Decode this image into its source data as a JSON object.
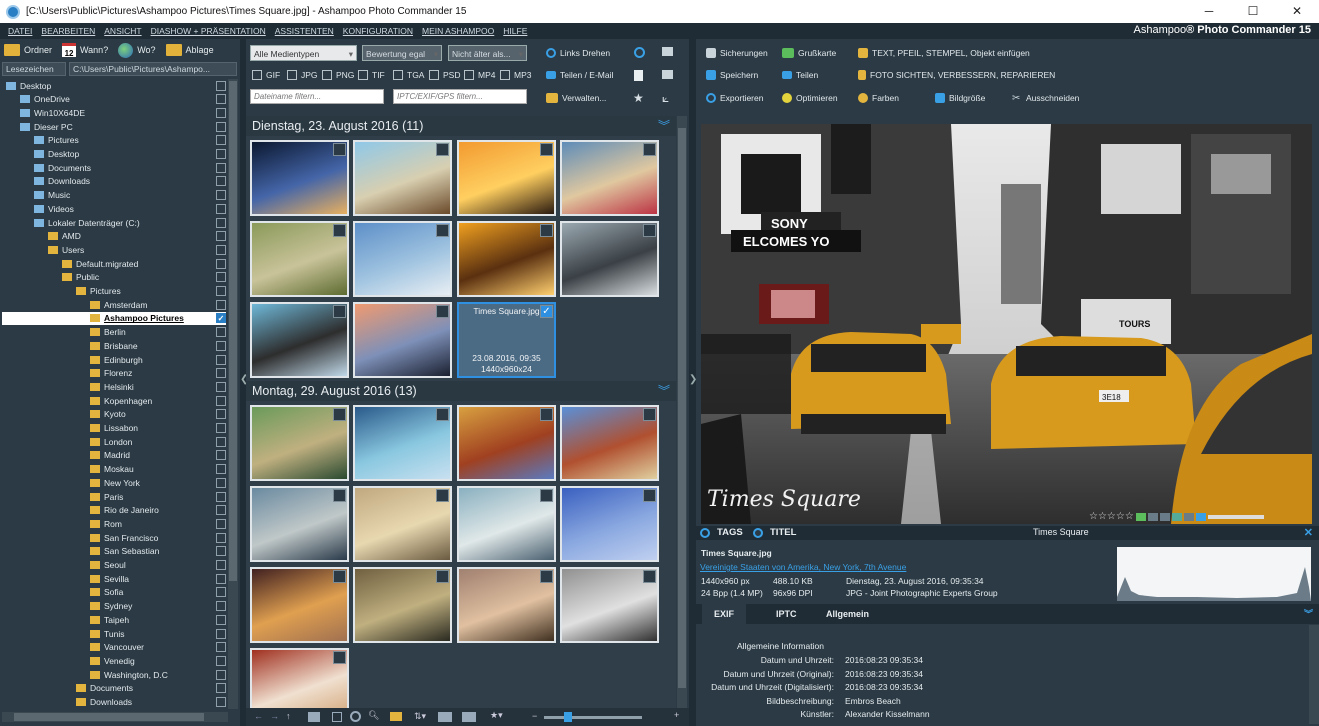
{
  "window": {
    "title": "[C:\\Users\\Public\\Pictures\\Ashampoo Pictures\\Times Square.jpg] - Ashampoo Photo Commander 15",
    "minimize": "─",
    "maximize": "☐",
    "close": "✕"
  },
  "menu": [
    "DATEI",
    "BEARBEITEN",
    "ANSICHT",
    "DIASHOW + PRÄSENTATION",
    "ASSISTENTEN",
    "KONFIGURATION",
    "MEIN ASHAMPOO",
    "HILFE"
  ],
  "brand": {
    "name": "Ashampoo",
    "suffix": "® Photo Commander 15"
  },
  "left": {
    "buttons": {
      "folder": "Ordner",
      "when": "Wann?",
      "where": "Wo?",
      "storage": "Ablage",
      "calendar_day": "12"
    },
    "bookmarks": "Lesezeichen",
    "path": "C:\\Users\\Public\\Pictures\\Ashampo...",
    "tree": [
      {
        "label": "Desktop",
        "depth": 0,
        "icon": "desktop"
      },
      {
        "label": "OneDrive",
        "depth": 1,
        "icon": "cloud"
      },
      {
        "label": "Win10X64DE",
        "depth": 1,
        "icon": "user"
      },
      {
        "label": "Dieser PC",
        "depth": 1,
        "icon": "pc"
      },
      {
        "label": "Pictures",
        "depth": 2,
        "icon": "drive"
      },
      {
        "label": "Desktop",
        "depth": 2,
        "icon": "drive"
      },
      {
        "label": "Documents",
        "depth": 2,
        "icon": "drive"
      },
      {
        "label": "Downloads",
        "depth": 2,
        "icon": "drive"
      },
      {
        "label": "Music",
        "depth": 2,
        "icon": "drive"
      },
      {
        "label": "Videos",
        "depth": 2,
        "icon": "drive"
      },
      {
        "label": "Lokaler Datenträger (C:)",
        "depth": 2,
        "icon": "drive"
      },
      {
        "label": "AMD",
        "depth": 3,
        "icon": "folder"
      },
      {
        "label": "Users",
        "depth": 3,
        "icon": "folder"
      },
      {
        "label": "Default.migrated",
        "depth": 4,
        "icon": "folder"
      },
      {
        "label": "Public",
        "depth": 4,
        "icon": "folder"
      },
      {
        "label": "Pictures",
        "depth": 5,
        "icon": "folder"
      },
      {
        "label": "Amsterdam",
        "depth": 6,
        "icon": "folder"
      },
      {
        "label": "Ashampoo Pictures",
        "depth": 6,
        "icon": "folder",
        "selected": true
      },
      {
        "label": "Berlin",
        "depth": 6,
        "icon": "folder"
      },
      {
        "label": "Brisbane",
        "depth": 6,
        "icon": "folder"
      },
      {
        "label": "Edinburgh",
        "depth": 6,
        "icon": "folder"
      },
      {
        "label": "Florenz",
        "depth": 6,
        "icon": "folder"
      },
      {
        "label": "Helsinki",
        "depth": 6,
        "icon": "folder"
      },
      {
        "label": "Kopenhagen",
        "depth": 6,
        "icon": "folder"
      },
      {
        "label": "Kyoto",
        "depth": 6,
        "icon": "folder"
      },
      {
        "label": "Lissabon",
        "depth": 6,
        "icon": "folder"
      },
      {
        "label": "London",
        "depth": 6,
        "icon": "folder"
      },
      {
        "label": "Madrid",
        "depth": 6,
        "icon": "folder"
      },
      {
        "label": "Moskau",
        "depth": 6,
        "icon": "folder"
      },
      {
        "label": "New York",
        "depth": 6,
        "icon": "folder"
      },
      {
        "label": "Paris",
        "depth": 6,
        "icon": "folder"
      },
      {
        "label": "Rio de Janeiro",
        "depth": 6,
        "icon": "folder"
      },
      {
        "label": "Rom",
        "depth": 6,
        "icon": "folder"
      },
      {
        "label": "San Francisco",
        "depth": 6,
        "icon": "folder"
      },
      {
        "label": "San Sebastian",
        "depth": 6,
        "icon": "folder"
      },
      {
        "label": "Seoul",
        "depth": 6,
        "icon": "folder"
      },
      {
        "label": "Sevilla",
        "depth": 6,
        "icon": "folder"
      },
      {
        "label": "Sofia",
        "depth": 6,
        "icon": "folder"
      },
      {
        "label": "Sydney",
        "depth": 6,
        "icon": "folder"
      },
      {
        "label": "Taipeh",
        "depth": 6,
        "icon": "folder"
      },
      {
        "label": "Tunis",
        "depth": 6,
        "icon": "folder"
      },
      {
        "label": "Vancouver",
        "depth": 6,
        "icon": "folder"
      },
      {
        "label": "Venedig",
        "depth": 6,
        "icon": "folder"
      },
      {
        "label": "Washington, D.C",
        "depth": 6,
        "icon": "folder"
      },
      {
        "label": "Documents",
        "depth": 5,
        "icon": "folder"
      },
      {
        "label": "Downloads",
        "depth": 5,
        "icon": "folder"
      }
    ]
  },
  "filters": {
    "media_type": "Alle Medientypen",
    "rating": "Bewertung egal",
    "age": "Nicht älter als...",
    "types": [
      "GIF",
      "JPG",
      "PNG",
      "TIF",
      "TGA",
      "PSD",
      "MP4",
      "MP3"
    ],
    "filename_placeholder": "Dateiname filtern...",
    "meta_placeholder": "IPTC/EXIF/GPS filtern..."
  },
  "mid_tools": {
    "rotate_left": "Links Drehen",
    "share": "Teilen / E-Mail",
    "manage": "Verwalten..."
  },
  "groups": [
    {
      "title": "Dienstag, 23. August 2016 (11)"
    },
    {
      "title": "Montag, 29. August 2016 (13)"
    }
  ],
  "selected_thumb": {
    "name": "Times Square.jpg",
    "date": "23.08.2016, 09:35",
    "size": "1440x960x24"
  },
  "toolbar": {
    "row1": [
      "Sicherungen",
      "Grußkarte",
      "TEXT, PFEIL, STEMPEL, Objekt einfügen"
    ],
    "row2": [
      "Speichern",
      "Teilen",
      "FOTO SICHTEN, VERBESSERN, REPARIEREN"
    ],
    "row3": [
      "Exportieren",
      "Optimieren",
      "Farben",
      "Bildgröße",
      "Ausschneiden"
    ]
  },
  "photo": {
    "watermark": "Times Square",
    "sign_sony": "SONY",
    "sign_welcomes": "ELCOMES YO",
    "sign_taxi": "3E18",
    "sign_tours": "TOURS"
  },
  "tags": {
    "tags": "TAGS",
    "title": "TITEL",
    "title_value": "Times Square"
  },
  "info": {
    "filename": "Times Square.jpg",
    "location": "Vereinigte Staaten von Amerika, New York, 7th Avenue",
    "dims": "1440x960 px",
    "bpp": "24 Bpp (1.4 MP)",
    "filesize": "488.10 KB",
    "dpi": "96x96 DPI",
    "date": "Dienstag, 23. August 2016, 09:35:34",
    "format": "JPG - Joint Photographic Experts Group"
  },
  "exif": {
    "tabs": [
      "EXIF",
      "IPTC",
      "Allgemein"
    ],
    "section": "Allgemeine Information",
    "rows": [
      {
        "k": "Datum und Uhrzeit:",
        "v": "2016:08:23 09:35:34"
      },
      {
        "k": "Datum und Uhrzeit (Original):",
        "v": "2016:08:23 09:35:34"
      },
      {
        "k": "Datum und Uhrzeit (Digitalisiert):",
        "v": "2016:08:23 09:35:34"
      },
      {
        "k": "Bildbeschreibung:",
        "v": "Embros Beach"
      },
      {
        "k": "Künstler:",
        "v": "Alexander Kisselmann"
      }
    ]
  }
}
